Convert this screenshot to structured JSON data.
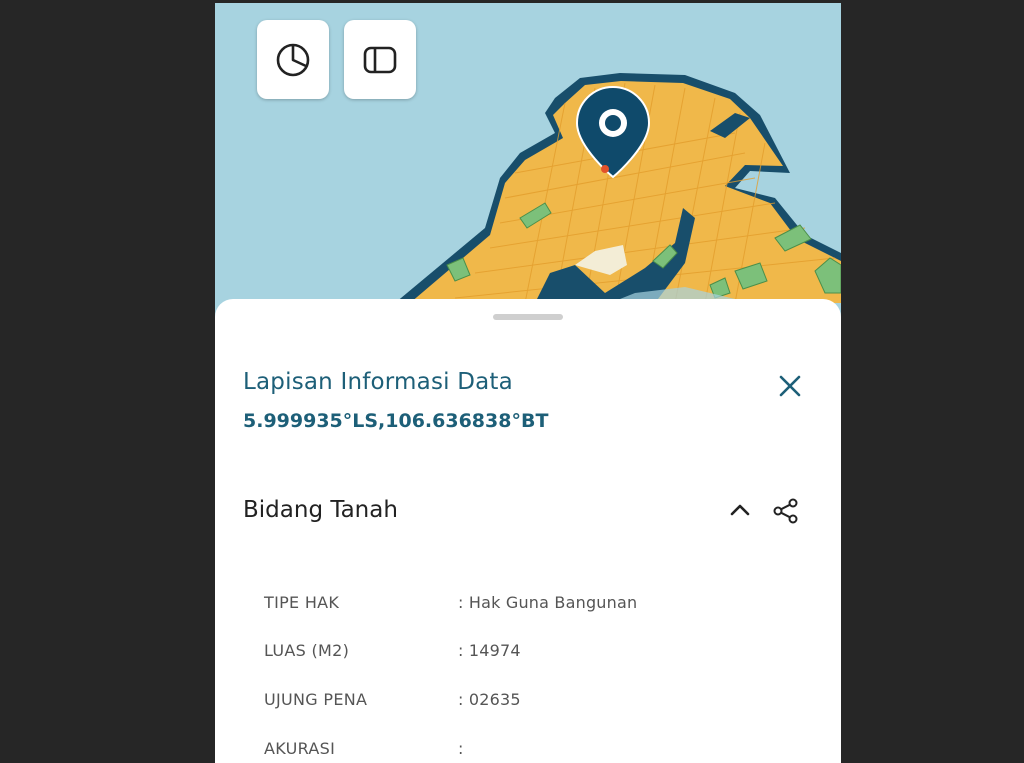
{
  "map": {
    "buttons": [
      {
        "icon": "pie-chart-icon"
      },
      {
        "icon": "sidebar-panel-icon"
      }
    ],
    "marker_icon": "location-pin-icon",
    "colors": {
      "water": "#a7d3e0",
      "land": "#f0b84a",
      "parcel_green": "#7cc07a",
      "outline": "#184e6b"
    }
  },
  "sheet": {
    "title": "Lapisan Informasi Data",
    "coordinates": "5.999935°LS,106.636838°BT",
    "close_icon": "close-icon",
    "section": {
      "title": "Bidang Tanah",
      "collapse_icon": "chevron-up-icon",
      "share_icon": "share-icon"
    },
    "attributes": [
      {
        "label": "TIPE HAK",
        "value": ": Hak Guna Bangunan"
      },
      {
        "label": "LUAS (M2)",
        "value": ": 14974"
      },
      {
        "label": "UJUNG PENA",
        "value": ": 02635"
      },
      {
        "label": "AKURASI",
        "value": ":"
      }
    ]
  }
}
